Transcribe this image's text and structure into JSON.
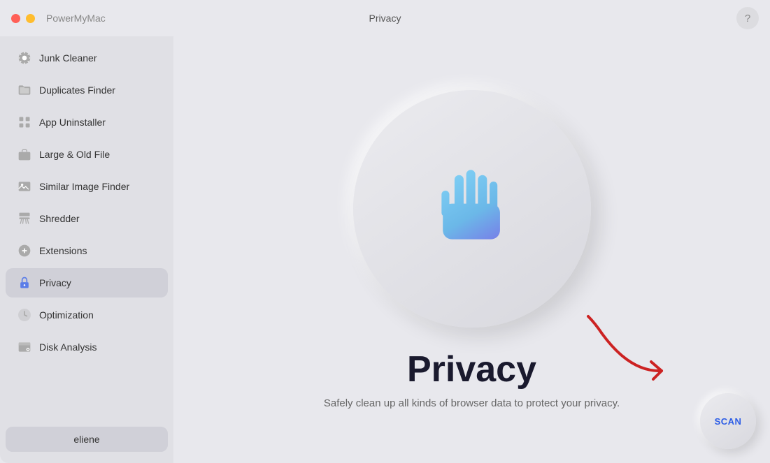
{
  "titleBar": {
    "appName": "PowerMyMac",
    "pageTitle": "Privacy",
    "helpLabel": "?"
  },
  "sidebar": {
    "items": [
      {
        "id": "junk-cleaner",
        "label": "Junk Cleaner",
        "icon": "gear-circle"
      },
      {
        "id": "duplicates-finder",
        "label": "Duplicates Finder",
        "icon": "folder"
      },
      {
        "id": "app-uninstaller",
        "label": "App Uninstaller",
        "icon": "app-grid"
      },
      {
        "id": "large-old-file",
        "label": "Large & Old File",
        "icon": "briefcase"
      },
      {
        "id": "similar-image-finder",
        "label": "Similar Image Finder",
        "icon": "photo"
      },
      {
        "id": "shredder",
        "label": "Shredder",
        "icon": "shredder"
      },
      {
        "id": "extensions",
        "label": "Extensions",
        "icon": "extensions"
      },
      {
        "id": "privacy",
        "label": "Privacy",
        "icon": "lock",
        "active": true
      },
      {
        "id": "optimization",
        "label": "Optimization",
        "icon": "optimization"
      },
      {
        "id": "disk-analysis",
        "label": "Disk Analysis",
        "icon": "disk"
      }
    ],
    "userButton": "eliene"
  },
  "content": {
    "title": "Privacy",
    "subtitle": "Safely clean up all kinds of browser data to protect your privacy.",
    "scanLabel": "SCAN"
  }
}
